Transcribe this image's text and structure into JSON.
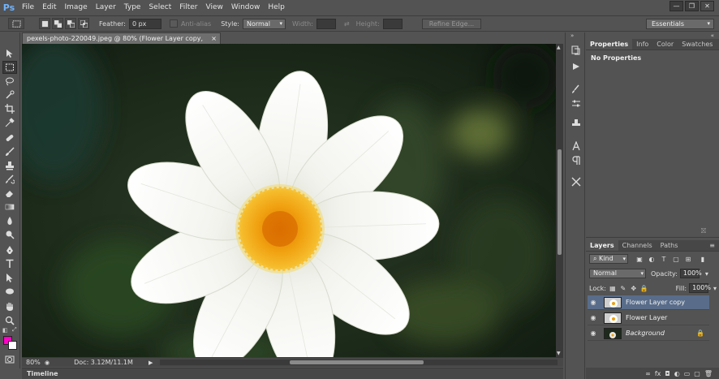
{
  "app": {
    "logo": "Ps",
    "menu": [
      "File",
      "Edit",
      "Image",
      "Layer",
      "Type",
      "Select",
      "Filter",
      "View",
      "Window",
      "Help"
    ]
  },
  "window_controls": {
    "minimize": "—",
    "restore": "❐",
    "close": "✕"
  },
  "options_bar": {
    "feather_label": "Feather:",
    "feather_value": "0 px",
    "antialias_label": "Anti-alias",
    "style_label": "Style:",
    "style_value": "Normal",
    "width_label": "Width:",
    "height_label": "Height:",
    "refine_edge_label": "Refine Edge...",
    "workspace": "Essentials"
  },
  "document": {
    "tab_title": "pexels-photo-220049.jpeg @ 80% (Flower Layer copy, RGB/8) *",
    "tab_close": "×",
    "zoom": "80%",
    "doc_info": "Doc: 3.12M/11.1M"
  },
  "timeline_label": "Timeline",
  "properties_panel": {
    "tabs": [
      "Properties",
      "Info",
      "Color",
      "Swatches"
    ],
    "message": "No Properties"
  },
  "layers_panel": {
    "tabs": [
      "Layers",
      "Channels",
      "Paths"
    ],
    "filter_kind": "Kind",
    "blend_mode": "Normal",
    "opacity_label": "Opacity:",
    "opacity_value": "100%",
    "lock_label": "Lock:",
    "fill_label": "Fill:",
    "fill_value": "100%",
    "layers": [
      {
        "name": "Flower Layer copy",
        "selected": true
      },
      {
        "name": "Flower Layer",
        "selected": false
      },
      {
        "name": "Background",
        "selected": false,
        "locked": true
      }
    ],
    "footer_icons": [
      "link-icon",
      "fx-icon",
      "mask-icon",
      "adjustment-icon",
      "group-icon",
      "new-layer-icon",
      "trash-icon"
    ],
    "footer_glyphs": {
      "link": "∞",
      "fx": "fx",
      "mask": "◘",
      "adjust": "◐",
      "group": "▭",
      "new": "▢",
      "trash": "🗑"
    }
  },
  "colors": {
    "foreground": "#ff00c8",
    "background": "#ffffff",
    "selected_layer": "#596d8a"
  },
  "tool_icons": [
    "move-icon",
    "marquee-icon",
    "lasso-icon",
    "quick-select-icon",
    "crop-icon",
    "eyedropper-icon",
    "healing-icon",
    "brush-icon",
    "clone-stamp-icon",
    "history-brush-icon",
    "eraser-icon",
    "gradient-icon",
    "blur-icon",
    "dodge-icon",
    "pen-icon",
    "type-icon",
    "path-select-icon",
    "shape-icon",
    "hand-icon",
    "zoom-icon"
  ]
}
